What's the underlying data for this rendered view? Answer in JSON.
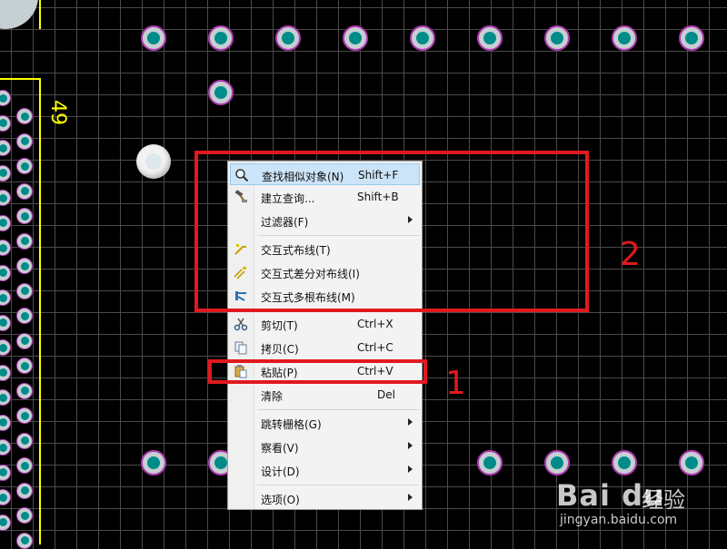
{
  "pcb": {
    "designator": "49",
    "colors": {
      "background": "#000000",
      "grid": "#4a4a4a",
      "pad_ring": "#b13ab1",
      "pad_copper": "#c6d0d2",
      "pad_hole": "#008b8b",
      "silkscreen": "#ffff00"
    }
  },
  "context_menu": {
    "items": [
      {
        "label": "查找相似对象(N)",
        "shortcut": "Shift+F",
        "icon": "magnifier-icon",
        "highlighted": true
      },
      {
        "label": "建立查询...",
        "shortcut": "Shift+B",
        "icon": "hammer-icon"
      },
      {
        "label": "过滤器(F)",
        "submenu": true
      },
      {
        "label": "交互式布线(T)",
        "icon": "route-icon"
      },
      {
        "label": "交互式差分对布线(I)",
        "icon": "diff-pair-route-icon"
      },
      {
        "label": "交互式多根布线(M)",
        "icon": "multi-route-icon"
      },
      {
        "label": "剪切(T)",
        "shortcut": "Ctrl+X",
        "icon": "scissors-icon"
      },
      {
        "label": "拷贝(C)",
        "shortcut": "Ctrl+C",
        "icon": "copy-icon"
      },
      {
        "label": "粘贴(P)",
        "shortcut": "Ctrl+V",
        "icon": "paste-icon"
      },
      {
        "label": "清除",
        "shortcut": "Del"
      },
      {
        "label": "跳转栅格(G)",
        "submenu": true
      },
      {
        "label": "察看(V)",
        "submenu": true
      },
      {
        "label": "设计(D)",
        "submenu": true
      },
      {
        "label": "选项(O)",
        "submenu": true
      }
    ]
  },
  "annotations": {
    "label_1": "1",
    "label_2": "2",
    "color": "#e0191f"
  },
  "watermark": {
    "logo": "Bai du",
    "name": "经验",
    "url": "jingyan.baidu.com"
  }
}
